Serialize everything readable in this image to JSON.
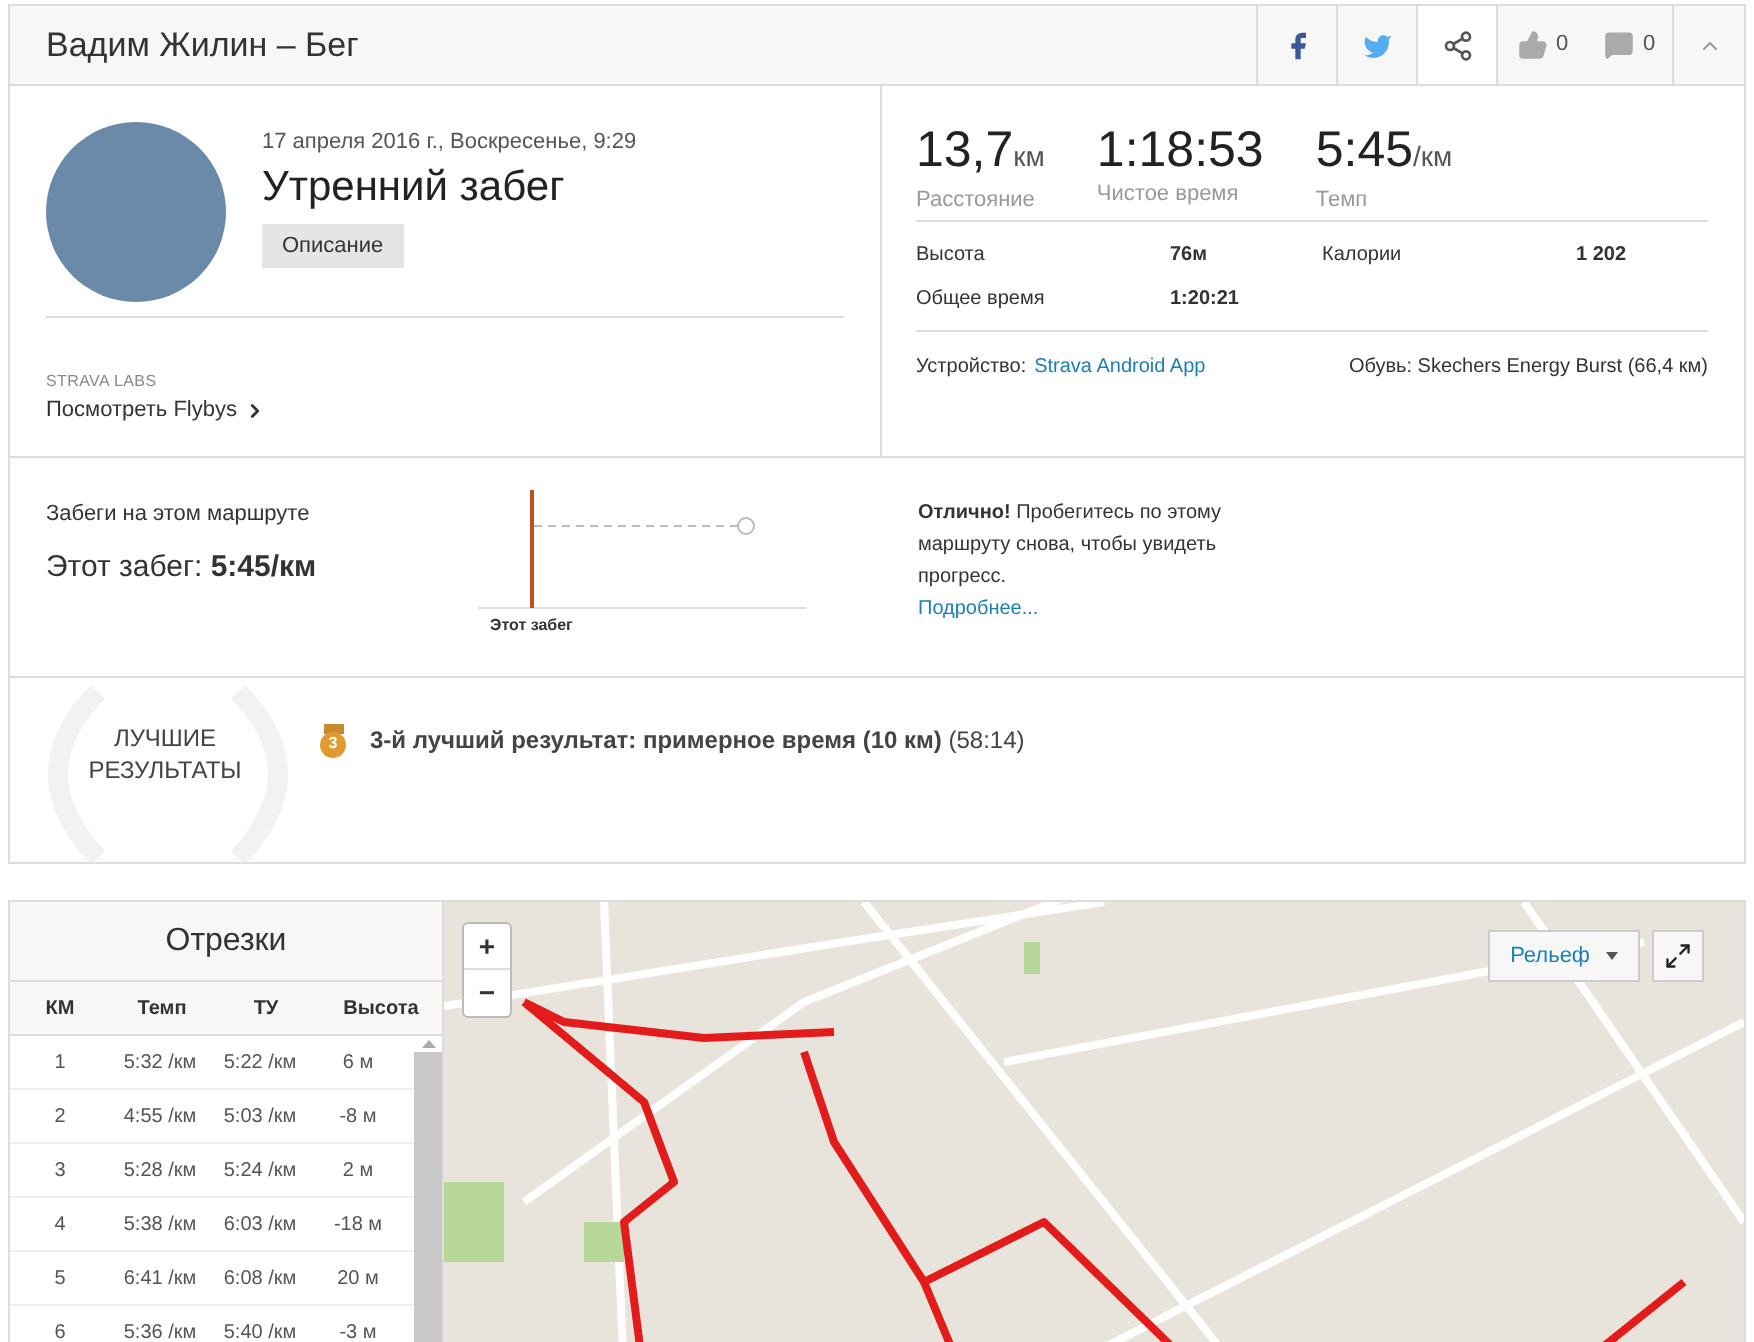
{
  "header": {
    "title": "Вадим Жилин – Бег",
    "likes": "0",
    "comments": "0",
    "collapsed": false
  },
  "activity": {
    "date": "17 апреля 2016 г., Воскресенье, 9:29",
    "title": "Утренний забег",
    "description_button": "Описание",
    "labs_label": "STRAVA LABS",
    "flybys_link": "Посмотреть Flybys"
  },
  "stats": [
    {
      "value": "13,7",
      "unit": "км",
      "label": "Расстояние"
    },
    {
      "value": "1:18:53",
      "label": "Чистое время"
    },
    {
      "value": "5:45",
      "unit": "/км",
      "label": "Темп"
    }
  ],
  "details": [
    {
      "label": "Высота",
      "value": "76м"
    },
    {
      "label": "Калории",
      "value": "1 202"
    },
    {
      "label": "Общее время",
      "value": "1:20:21"
    }
  ],
  "device": {
    "label": "Устройство:",
    "value": "Strava Android App"
  },
  "shoes": "Обувь: Skechers Energy Burst (66,4 км)",
  "route": {
    "heading": "Забеги на этом маршруте",
    "this_run_label": "Этот забег:",
    "this_run_value": "5:45/км",
    "chart_label": "Этот забег",
    "message": "**Отлично!** Пробегитесь по этому маршруту снова, чтобы увидеть прогресс.",
    "more_link": "Подробнее..."
  },
  "best": {
    "label": "ЛУЧШИЕ РЕЗУЛЬТАТЫ",
    "items": [
      {
        "medal": "3",
        "text": "**3-й лучший результат: примерное время (10 км)** (58:14)"
      }
    ]
  },
  "splits": {
    "title": "Отрезки",
    "columns": [
      "КМ",
      "Темп",
      "ТУ",
      "Высота"
    ],
    "rows": [
      [
        "1",
        "5:32 /км",
        "5:22 /км",
        "6 м"
      ],
      [
        "2",
        "4:55 /км",
        "5:03 /км",
        "-8 м"
      ],
      [
        "3",
        "5:28 /км",
        "5:24 /км",
        "2 м"
      ],
      [
        "4",
        "5:38 /км",
        "6:03 /км",
        "-18 м"
      ],
      [
        "5",
        "6:41 /км",
        "6:08 /км",
        "20 м"
      ],
      [
        "6",
        "5:36 /км",
        "5:40 /км",
        "-3 м"
      ]
    ]
  },
  "map": {
    "zoom_in": "+",
    "zoom_out": "−",
    "layer": "Рельеф"
  }
}
